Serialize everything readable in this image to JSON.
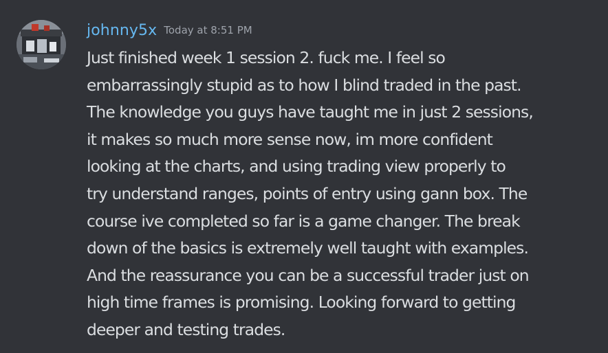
{
  "message": {
    "author": "johnny5x",
    "timestamp": "Today at 8:51 PM",
    "avatar_icon": "user-avatar-photo",
    "username_color": "#66b8f0",
    "lines": [
      "Just finished week 1 session 2. fuck me. I feel so",
      "embarrassingly stupid as to how I blind traded in the past.",
      "The knowledge you guys have taught me in just 2 sessions,",
      "it makes so much more sense now, im more confident",
      "looking at the charts, and using trading view properly to",
      "try understand ranges, points of entry using gann box. The",
      "course ive completed so far is a game changer. The break",
      "down of the basics is extremely well taught with examples.",
      "And the reassurance you can be a successful trader just on",
      "high time frames is promising. Looking forward to getting",
      "deeper and testing trades."
    ]
  }
}
